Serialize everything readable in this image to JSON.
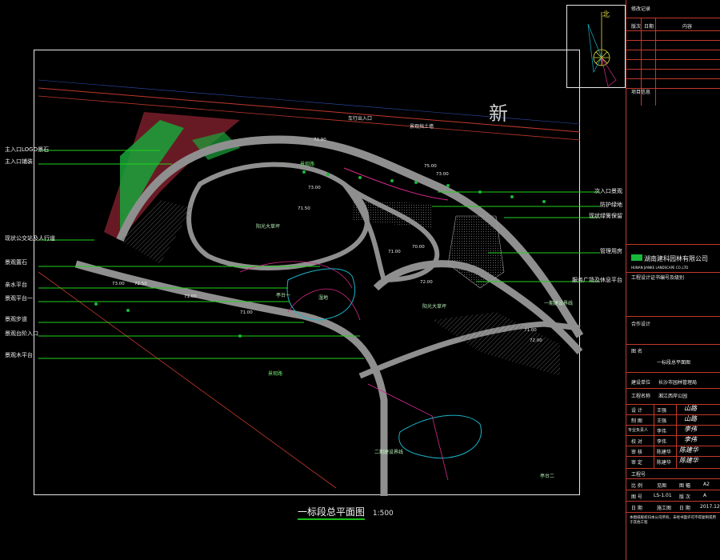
{
  "sheet": {
    "title": "一标段总平面图",
    "scale": "1:500"
  },
  "big_character": "新",
  "north": {
    "label": "北"
  },
  "callouts_left": [
    "主入口LOGO景石",
    "主入口铺装",
    "现状公交站及人行道",
    "景观置石",
    "亲水平台",
    "景观平台一",
    "景观步道",
    "景观台阶入口",
    "景观木平台"
  ],
  "callouts_right": [
    "次入口景观",
    "防护绿地",
    "现状绿篱保留",
    "管理用房",
    "服务广场及休息平台"
  ],
  "plan_labels": {
    "entrance": "车行出入口",
    "feature_wall": "景观挡土墙",
    "lawn_a": "阳光大草坪",
    "lawn_b": "阳光大草坪",
    "pond": "湿地",
    "stage1": "一期建设界线",
    "stage2": "二期建设界线",
    "pavilion": "亭台一",
    "road_a": "景观路",
    "road_b": "景观路",
    "plaza": "亭台二"
  },
  "elevations": [
    "72.90",
    "75.00",
    "71.50",
    "73.00",
    "71.00",
    "72.00",
    "71.00",
    "73.00",
    "72.50",
    "71.00",
    "70.00",
    "71.00",
    "72.00",
    "73.00"
  ],
  "title_block": {
    "header": "修改记录",
    "cols": [
      "版次",
      "日期",
      "内容"
    ],
    "project_info": "项目信息",
    "company": "湖南建科园林有限公司",
    "company_en": "HUNAN JIANKE LANDSCAPE CO.,LTD",
    "cert": "工程设计证书编号及级别",
    "coop": "合作设计",
    "drawing_name_label": "图 名",
    "drawing_name": "一标段总平面图",
    "client_label": "建设单位",
    "client": "长沙市园林管理局",
    "project_label": "工程名称",
    "project": "湘江西岸公园",
    "roles": [
      {
        "role": "设 计",
        "name": "王强",
        "sig": "山路"
      },
      {
        "role": "制 图",
        "name": "王强",
        "sig": "山路"
      },
      {
        "role": "专业负责人",
        "name": "李伟",
        "sig": "李伟"
      },
      {
        "role": "校 对",
        "name": "李伟",
        "sig": "李伟"
      },
      {
        "role": "审 核",
        "name": "陈建华",
        "sig": "陈建华"
      },
      {
        "role": "审 定",
        "name": "陈建华",
        "sig": "陈建华"
      }
    ],
    "drawing_no_label": "工程号",
    "rows": [
      {
        "a": "比 例",
        "b": "见图",
        "c": "图 幅",
        "d": "A2"
      },
      {
        "a": "图 号",
        "b": "LS-1.01",
        "c": "版 次",
        "d": "A"
      },
      {
        "a": "日 期",
        "b": "施工图",
        "c": "日 期",
        "d": "2017.12"
      }
    ],
    "footer": "本图纸版权归本公司所有，未经书面许可不得复制或用于其他工程"
  },
  "colors": {
    "frame": "#e8e8e8",
    "road": "#9a9a9a",
    "contour": "#d42a8a",
    "plant": "#18b83a",
    "red_line": "#c0392b",
    "callout_line": "#22d020",
    "water": "#1bb3c8"
  }
}
